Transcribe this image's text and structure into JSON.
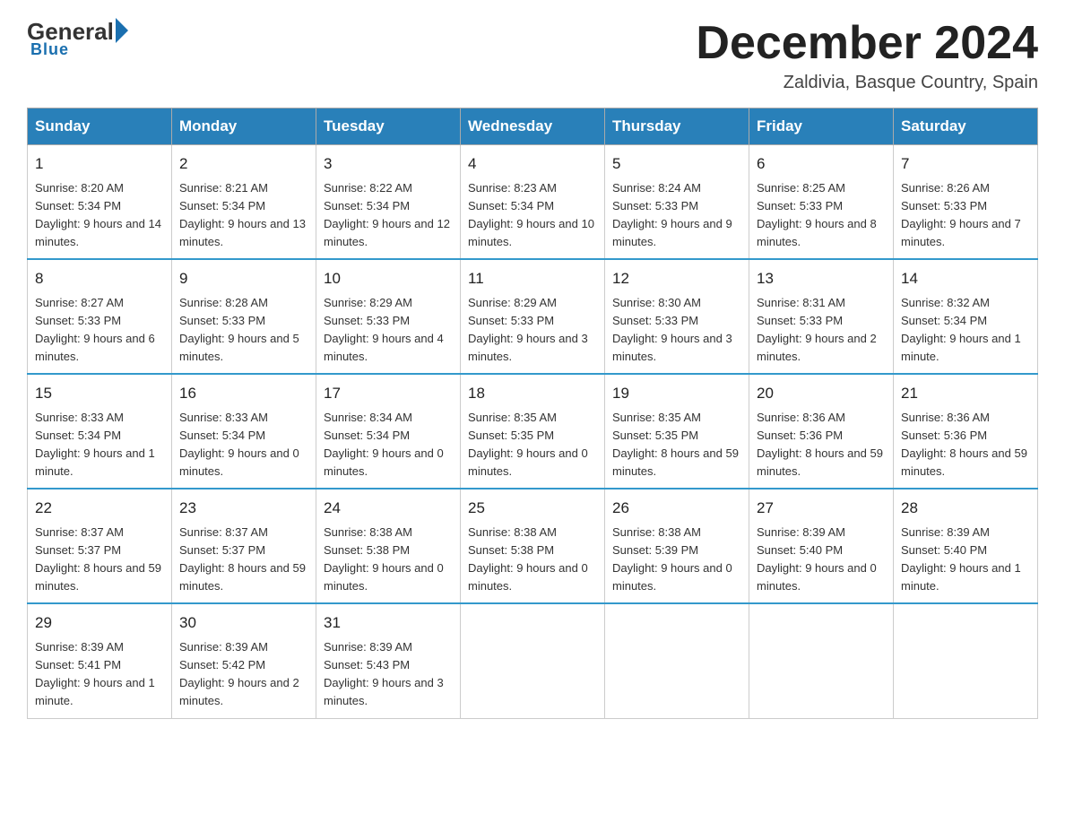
{
  "header": {
    "logo": {
      "general": "General",
      "blue": "Blue",
      "underline": "Blue"
    },
    "title": "December 2024",
    "location": "Zaldivia, Basque Country, Spain"
  },
  "calendar": {
    "days_of_week": [
      "Sunday",
      "Monday",
      "Tuesday",
      "Wednesday",
      "Thursday",
      "Friday",
      "Saturday"
    ],
    "weeks": [
      [
        {
          "day": "1",
          "sunrise": "8:20 AM",
          "sunset": "5:34 PM",
          "daylight": "9 hours and 14 minutes."
        },
        {
          "day": "2",
          "sunrise": "8:21 AM",
          "sunset": "5:34 PM",
          "daylight": "9 hours and 13 minutes."
        },
        {
          "day": "3",
          "sunrise": "8:22 AM",
          "sunset": "5:34 PM",
          "daylight": "9 hours and 12 minutes."
        },
        {
          "day": "4",
          "sunrise": "8:23 AM",
          "sunset": "5:34 PM",
          "daylight": "9 hours and 10 minutes."
        },
        {
          "day": "5",
          "sunrise": "8:24 AM",
          "sunset": "5:33 PM",
          "daylight": "9 hours and 9 minutes."
        },
        {
          "day": "6",
          "sunrise": "8:25 AM",
          "sunset": "5:33 PM",
          "daylight": "9 hours and 8 minutes."
        },
        {
          "day": "7",
          "sunrise": "8:26 AM",
          "sunset": "5:33 PM",
          "daylight": "9 hours and 7 minutes."
        }
      ],
      [
        {
          "day": "8",
          "sunrise": "8:27 AM",
          "sunset": "5:33 PM",
          "daylight": "9 hours and 6 minutes."
        },
        {
          "day": "9",
          "sunrise": "8:28 AM",
          "sunset": "5:33 PM",
          "daylight": "9 hours and 5 minutes."
        },
        {
          "day": "10",
          "sunrise": "8:29 AM",
          "sunset": "5:33 PM",
          "daylight": "9 hours and 4 minutes."
        },
        {
          "day": "11",
          "sunrise": "8:29 AM",
          "sunset": "5:33 PM",
          "daylight": "9 hours and 3 minutes."
        },
        {
          "day": "12",
          "sunrise": "8:30 AM",
          "sunset": "5:33 PM",
          "daylight": "9 hours and 3 minutes."
        },
        {
          "day": "13",
          "sunrise": "8:31 AM",
          "sunset": "5:33 PM",
          "daylight": "9 hours and 2 minutes."
        },
        {
          "day": "14",
          "sunrise": "8:32 AM",
          "sunset": "5:34 PM",
          "daylight": "9 hours and 1 minute."
        }
      ],
      [
        {
          "day": "15",
          "sunrise": "8:33 AM",
          "sunset": "5:34 PM",
          "daylight": "9 hours and 1 minute."
        },
        {
          "day": "16",
          "sunrise": "8:33 AM",
          "sunset": "5:34 PM",
          "daylight": "9 hours and 0 minutes."
        },
        {
          "day": "17",
          "sunrise": "8:34 AM",
          "sunset": "5:34 PM",
          "daylight": "9 hours and 0 minutes."
        },
        {
          "day": "18",
          "sunrise": "8:35 AM",
          "sunset": "5:35 PM",
          "daylight": "9 hours and 0 minutes."
        },
        {
          "day": "19",
          "sunrise": "8:35 AM",
          "sunset": "5:35 PM",
          "daylight": "8 hours and 59 minutes."
        },
        {
          "day": "20",
          "sunrise": "8:36 AM",
          "sunset": "5:36 PM",
          "daylight": "8 hours and 59 minutes."
        },
        {
          "day": "21",
          "sunrise": "8:36 AM",
          "sunset": "5:36 PM",
          "daylight": "8 hours and 59 minutes."
        }
      ],
      [
        {
          "day": "22",
          "sunrise": "8:37 AM",
          "sunset": "5:37 PM",
          "daylight": "8 hours and 59 minutes."
        },
        {
          "day": "23",
          "sunrise": "8:37 AM",
          "sunset": "5:37 PM",
          "daylight": "8 hours and 59 minutes."
        },
        {
          "day": "24",
          "sunrise": "8:38 AM",
          "sunset": "5:38 PM",
          "daylight": "9 hours and 0 minutes."
        },
        {
          "day": "25",
          "sunrise": "8:38 AM",
          "sunset": "5:38 PM",
          "daylight": "9 hours and 0 minutes."
        },
        {
          "day": "26",
          "sunrise": "8:38 AM",
          "sunset": "5:39 PM",
          "daylight": "9 hours and 0 minutes."
        },
        {
          "day": "27",
          "sunrise": "8:39 AM",
          "sunset": "5:40 PM",
          "daylight": "9 hours and 0 minutes."
        },
        {
          "day": "28",
          "sunrise": "8:39 AM",
          "sunset": "5:40 PM",
          "daylight": "9 hours and 1 minute."
        }
      ],
      [
        {
          "day": "29",
          "sunrise": "8:39 AM",
          "sunset": "5:41 PM",
          "daylight": "9 hours and 1 minute."
        },
        {
          "day": "30",
          "sunrise": "8:39 AM",
          "sunset": "5:42 PM",
          "daylight": "9 hours and 2 minutes."
        },
        {
          "day": "31",
          "sunrise": "8:39 AM",
          "sunset": "5:43 PM",
          "daylight": "9 hours and 3 minutes."
        },
        null,
        null,
        null,
        null
      ]
    ]
  }
}
